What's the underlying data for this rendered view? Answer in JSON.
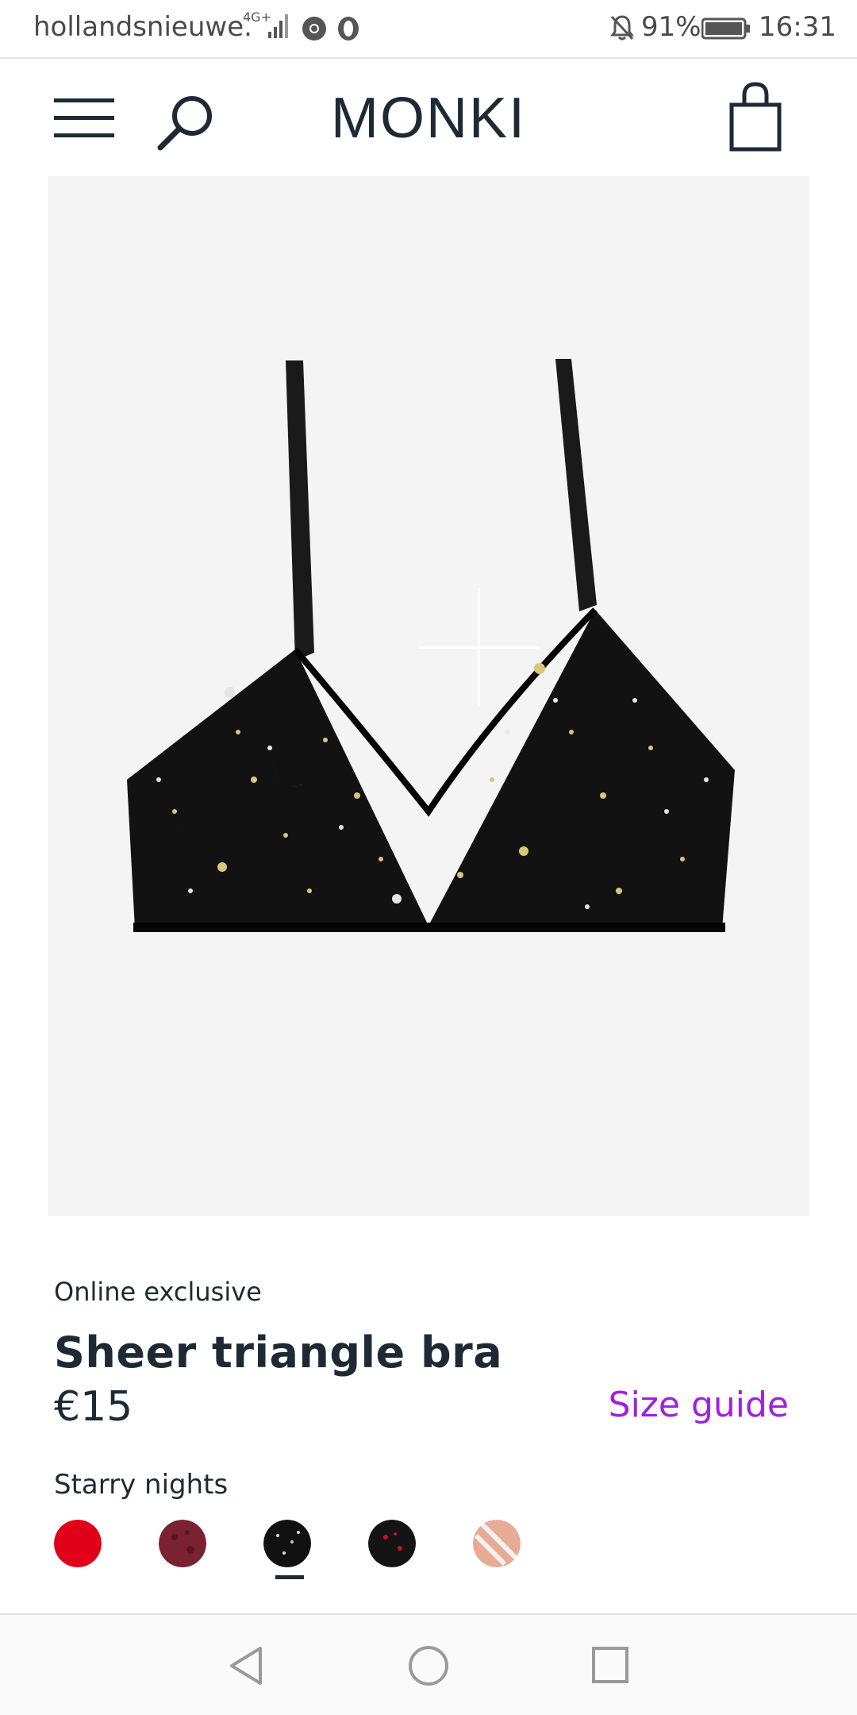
{
  "status_bar": {
    "carrier": "hollandsnieuwe.",
    "network": "4G+",
    "battery": "91%",
    "time": "16:31",
    "icons": [
      "signal-icon",
      "chrome-icon",
      "opera-icon",
      "bell-muted-icon",
      "battery-icon"
    ]
  },
  "header": {
    "logo": "MONKI",
    "icons": [
      "menu-icon",
      "search-icon",
      "shopping-bag-icon"
    ]
  },
  "product": {
    "tag": "Online exclusive",
    "title": "Sheer triangle bra",
    "price": "€15",
    "size_guide_label": "Size guide",
    "color_name": "Starry nights",
    "swatches": [
      {
        "name": "red",
        "color": "#e0001a"
      },
      {
        "name": "burgundy-pattern",
        "color": "#7a2232"
      },
      {
        "name": "starry-nights",
        "color": "#111111",
        "selected": true
      },
      {
        "name": "black-red-dots",
        "color": "#141414"
      },
      {
        "name": "nude-striped",
        "color": "#e8ab96"
      }
    ]
  },
  "colors": {
    "text": "#1e2a33",
    "accent": "#a020e0",
    "image_bg": "#f4f4f4"
  },
  "nav": {
    "icons": [
      "back-icon",
      "home-icon",
      "recent-apps-icon"
    ]
  }
}
